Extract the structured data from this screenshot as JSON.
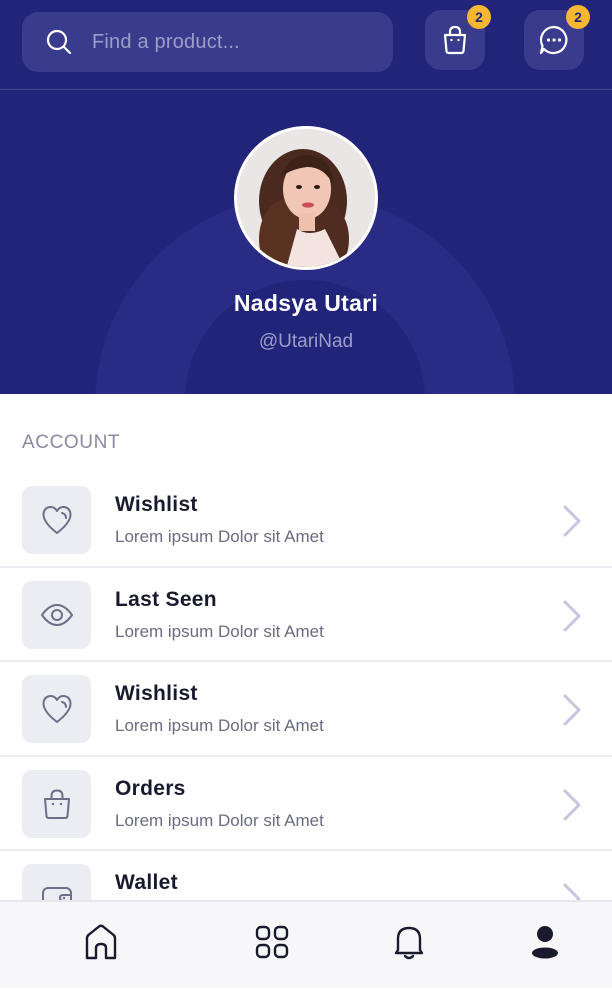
{
  "search": {
    "placeholder": "Find a product..."
  },
  "header_actions": {
    "cart_badge": "2",
    "chat_badge": "2"
  },
  "profile": {
    "name": "Nadsya Utari",
    "handle": "@UtariNad"
  },
  "account": {
    "section_title": "ACCOUNT",
    "items": [
      {
        "title": "Wishlist",
        "description": "Lorem ipsum Dolor sit Amet",
        "icon": "heart-icon"
      },
      {
        "title": "Last Seen",
        "description": "Lorem ipsum Dolor sit Amet",
        "icon": "eye-icon"
      },
      {
        "title": "Wishlist",
        "description": "Lorem ipsum Dolor sit Amet",
        "icon": "heart-icon"
      },
      {
        "title": "Orders",
        "description": "Lorem ipsum Dolor sit Amet",
        "icon": "bag-icon"
      },
      {
        "title": "Wallet",
        "description": "",
        "icon": "wallet-icon"
      }
    ]
  },
  "bottom_nav": {
    "items": [
      "home-icon",
      "grid-icon",
      "bell-icon",
      "profile-icon"
    ],
    "active": "profile-icon"
  },
  "colors": {
    "primary": "#22247a",
    "badge": "#f7b731",
    "icon_box": "#ececf3",
    "chevron": "#c5c5dd"
  }
}
